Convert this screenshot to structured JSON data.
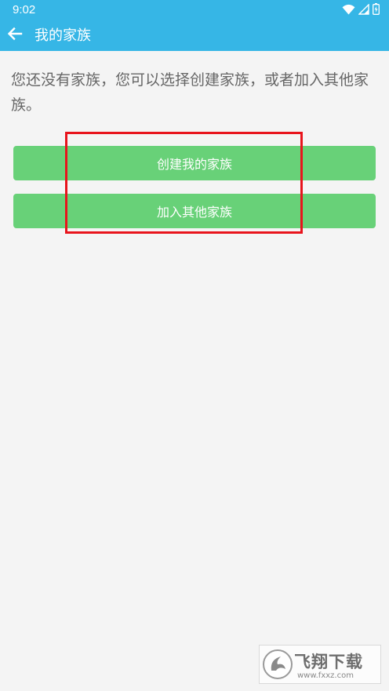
{
  "status_bar": {
    "time": "9:02",
    "icons": [
      "wifi-icon",
      "signal-icon",
      "battery-icon"
    ]
  },
  "app_bar": {
    "back_icon": "arrow-left-icon",
    "title": "我的家族"
  },
  "main": {
    "message": "您还没有家族，您可以选择创建家族，或者加入其他家族。",
    "create_button_label": "创建我的家族",
    "join_button_label": "加入其他家族"
  },
  "annotation": {
    "highlight_color": "#e8141c"
  },
  "watermark": {
    "text": "飞翔下载",
    "url": "www.fxxz.com"
  },
  "colors": {
    "primary": "#36b6e6",
    "button": "#68d178",
    "background": "#f4f4f4",
    "text": "#666666"
  }
}
